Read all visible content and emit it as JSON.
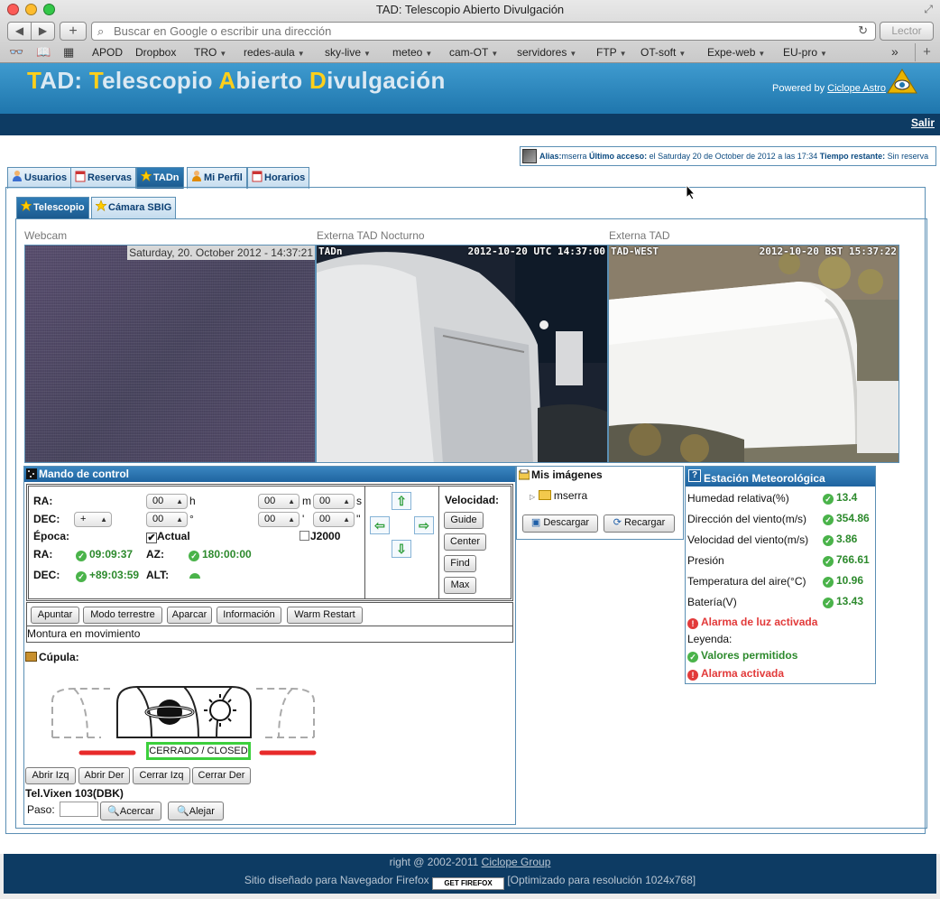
{
  "browser": {
    "window_title": "TAD: Telescopio Abierto Divulgación",
    "url_placeholder": "Buscar en Google o escribir una dirección",
    "reader_label": "Lector",
    "bookmarks": [
      {
        "label": "APOD"
      },
      {
        "label": "Dropbox"
      },
      {
        "label": "TRO"
      },
      {
        "label": "redes-aula"
      },
      {
        "label": "sky-live"
      },
      {
        "label": "meteo"
      },
      {
        "label": "cam-OT"
      },
      {
        "label": "servidores"
      },
      {
        "label": "FTP"
      },
      {
        "label": "OT-soft"
      },
      {
        "label": "Expe-web"
      },
      {
        "label": "EU-pro"
      }
    ]
  },
  "header": {
    "title_parts": [
      "T",
      "AD: ",
      "T",
      "elescopio ",
      "A",
      "bierto ",
      "D",
      "ivulgación"
    ],
    "powered_by": "Powered by",
    "powered_link": "Ciclope Astro",
    "logout": "Salir"
  },
  "userinfo": {
    "alias_label": "Alias:",
    "alias": "mserra",
    "last_access_label": "Último acceso:",
    "last_access": "el Saturday 20 de October de 2012 a las 17:34",
    "remaining_label": "Tiempo restante:",
    "remaining": "Sin reserva"
  },
  "tabs": [
    "Usuarios",
    "Reservas",
    "TADn",
    "Mi Perfil",
    "Horarios"
  ],
  "subtabs": [
    "Telescopio",
    "Cámara SBIG"
  ],
  "cams": {
    "webcam": {
      "label": "Webcam",
      "stamp": "Saturday, 20. October 2012 - 14:37:21"
    },
    "night": {
      "label": "Externa TAD Nocturno",
      "osd_left": "TADn",
      "osd_right": "2012-10-20 UTC 14:37:00"
    },
    "ext": {
      "label": "Externa TAD",
      "osd_left": "TAD-WEST",
      "osd_right": "2012-10-20 BST 15:37:22"
    }
  },
  "mando": {
    "title": "Mando de control",
    "ra_label": "RA:",
    "dec_label": "DEC:",
    "ra_h": "00",
    "ra_m": "00",
    "ra_s": "00",
    "dec_sign": "+",
    "dec_d": "00",
    "dec_m": "00",
    "dec_s": "00",
    "unit_h": "h",
    "unit_m": "m",
    "unit_s": "s",
    "unit_deg": "°",
    "unit_min": "'",
    "unit_sec": "''",
    "epoca_label": "Época:",
    "actual_label": "Actual",
    "j2000_label": "J2000",
    "ra_value": "09:09:37",
    "dec_value": "+89:03:59",
    "az_label": "AZ:",
    "az_value": "180:00:00",
    "alt_label": "ALT:",
    "velocidad_label": "Velocidad:",
    "speeds": [
      "Guide",
      "Center",
      "Find",
      "Max"
    ],
    "actions": [
      "Apuntar",
      "Modo terrestre",
      "Aparcar",
      "Información",
      "Warm Restart"
    ],
    "status": "Montura en movimiento"
  },
  "cupula": {
    "title": "Cúpula:",
    "state": "CERRADO / CLOSED",
    "buttons": [
      "Abrir Izq",
      "Abrir Der",
      "Cerrar Izq",
      "Cerrar Der"
    ],
    "telescope": "Tel.Vixen 103(DBK)",
    "paso_label": "Paso:",
    "acercar": "Acercar",
    "alejar": "Alejar"
  },
  "misimagenes": {
    "title": "Mis imágenes",
    "folder": "mserra",
    "descargar": "Descargar",
    "recargar": "Recargar"
  },
  "meteo": {
    "title": "Estación Meteorológica",
    "rows": [
      {
        "label": "Humedad relativa(%)",
        "value": "13.4"
      },
      {
        "label": "Dirección del viento(m/s)",
        "value": "354.86"
      },
      {
        "label": "Velocidad del viento(m/s)",
        "value": "3.86"
      },
      {
        "label": "Presión",
        "value": "766.61"
      },
      {
        "label": "Temperatura del aire(°C)",
        "value": "10.96"
      },
      {
        "label": "Batería(V)",
        "value": "13.43"
      }
    ],
    "alarm": "Alarma de luz activada",
    "legend_label": "Leyenda:",
    "legend_ok": "Valores permitidos",
    "legend_alarm": "Alarma activada"
  },
  "footer": {
    "line1_prefix": "right @ 2002-2011",
    "line1_link": "Ciclope Group",
    "line2_prefix": "Sitio diseñado para Navegador Firefox",
    "badge": "GET FIREFOX",
    "line2_suffix": "[Optimizado para resolución 1024x768]"
  },
  "colors": {
    "header_blue": "#1f76ad",
    "dark_navy": "#0d3b63",
    "title_yellow": "#ffcf1a",
    "ok_green": "#2d8a2d",
    "alarm_red": "#e23a3a",
    "dome_status_green": "#3ccf3c"
  }
}
